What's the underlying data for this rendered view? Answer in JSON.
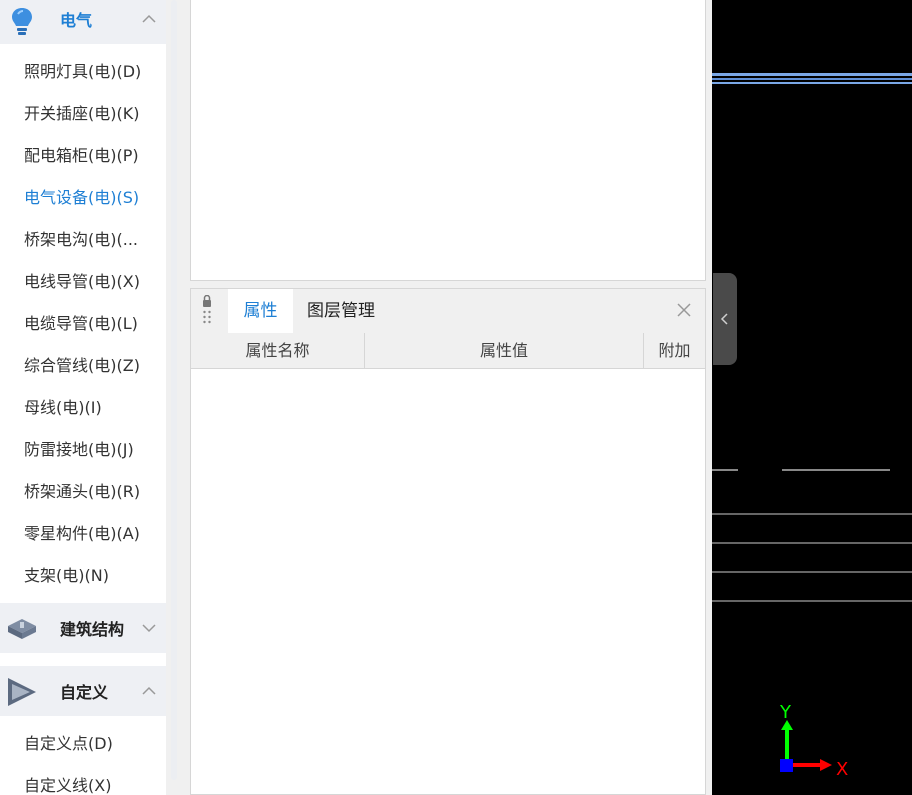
{
  "sidebar": {
    "electrical": {
      "label": "电气",
      "items": [
        {
          "label": "照明灯具(电)(D)"
        },
        {
          "label": "开关插座(电)(K)"
        },
        {
          "label": "配电箱柜(电)(P)"
        },
        {
          "label": "电气设备(电)(S)",
          "active": true
        },
        {
          "label": "桥架电沟(电)(..."
        },
        {
          "label": "电线导管(电)(X)"
        },
        {
          "label": "电缆导管(电)(L)"
        },
        {
          "label": "综合管线(电)(Z)"
        },
        {
          "label": "母线(电)(I)"
        },
        {
          "label": "防雷接地(电)(J)"
        },
        {
          "label": "桥架通头(电)(R)"
        },
        {
          "label": "零星构件(电)(A)"
        },
        {
          "label": "支架(电)(N)"
        }
      ]
    },
    "structure": {
      "label": "建筑结构"
    },
    "custom": {
      "label": "自定义",
      "items": [
        {
          "label": "自定义点(D)"
        },
        {
          "label": "自定义线(X)"
        }
      ]
    }
  },
  "properties_panel": {
    "tabs": [
      {
        "label": "属性",
        "active": true
      },
      {
        "label": "图层管理"
      }
    ],
    "columns": [
      "属性名称",
      "属性值",
      "附加"
    ]
  },
  "canvas": {
    "axis_y_label": "Y",
    "axis_x_label": "X",
    "colors": {
      "background": "#000000",
      "y_axis": "#00ff00",
      "x_axis": "#ff0000",
      "origin": "#0000ff",
      "accent": "#1e7fd4"
    }
  }
}
